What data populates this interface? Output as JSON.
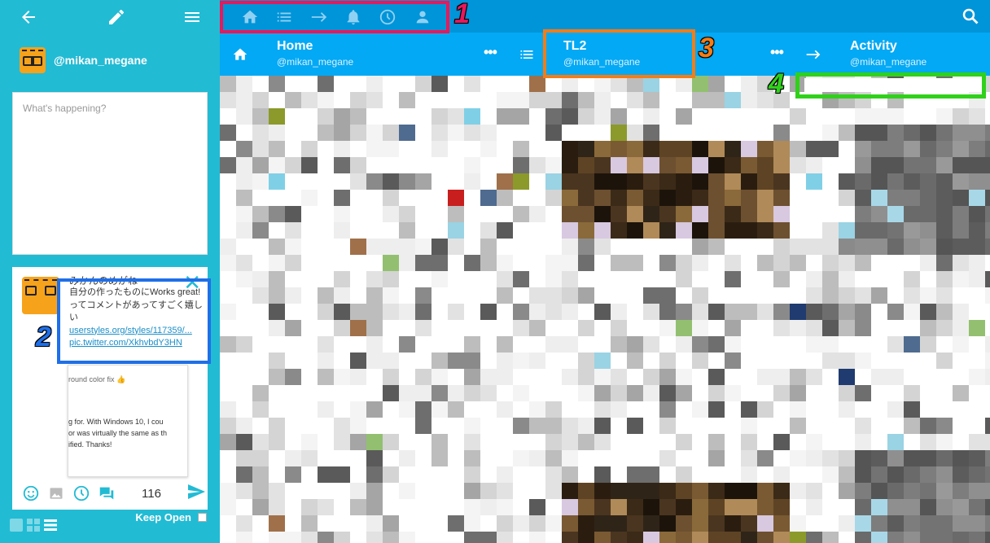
{
  "sidebar": {
    "account_handle": "@mikan_megane",
    "compose_placeholder": "What's happening?",
    "tweet": {
      "name": "みかんのめがね",
      "text": "自分の作ったものにWorks great!ってコメントがあってすごく嬉しい",
      "link1": "userstyles.org/styles/117359/...",
      "link2": "pic.twitter.com/XkhvbdY3HN",
      "image_lines": [
        "round color fix 👍",
        "g for. With Windows 10, I cou",
        "or was virtually the same as th",
        "ified. Thanks!"
      ]
    },
    "char_count": "116",
    "keep_open_label": "Keep Open"
  },
  "columns": [
    {
      "title": "Home",
      "user": "@mikan_megane",
      "icon": "home-icon"
    },
    {
      "title": "TL2",
      "user": "@mikan_megane",
      "icon": "list-icon"
    },
    {
      "title": "Activity",
      "user": "@mikan_megane",
      "icon": "arrow-right-icon"
    }
  ],
  "annotations": {
    "n1": "1",
    "n2": "2",
    "n3": "3",
    "n4": "4"
  },
  "colors": {
    "sidebar": "#22bbd4",
    "topbar": "#0094d9",
    "column_header": "#03a9f4",
    "annotation_1": "#e8185a",
    "annotation_2": "#1f6fe8",
    "annotation_3": "#f57c15",
    "annotation_4": "#2fd11a"
  }
}
